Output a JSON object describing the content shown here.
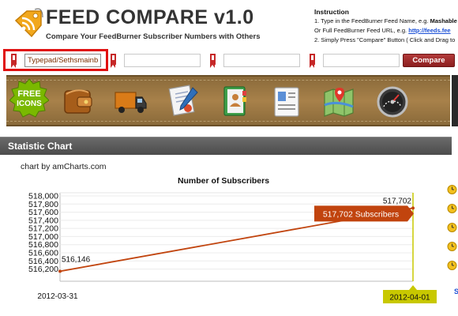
{
  "app": {
    "title": "FEED COMPARE v1.0",
    "subtitle": "Compare Your FeedBurner Subscriber Numbers with Others"
  },
  "instruction": {
    "heading": "Instruction",
    "line1_prefix": "1. Type in the FeedBurner Feed Name, e.g.",
    "line1_example": "Mashable",
    "line2_prefix": "Or Full FeedBurner Feed URL, e.g.",
    "line2_link": "http://feeds.fee",
    "line3": "2. Simply Press \"Compare\" Button ( Click and Drag to"
  },
  "feeds": {
    "inputs": [
      {
        "value": "Typepad/Sethsmainblog",
        "placeholder": ""
      },
      {
        "value": "",
        "placeholder": ""
      },
      {
        "value": "",
        "placeholder": ""
      },
      {
        "value": "",
        "placeholder": ""
      }
    ],
    "compare_label": "Compare"
  },
  "banner": {
    "badge_line1": "FREE",
    "badge_line2": "ICONS",
    "icons": [
      "wallet-icon",
      "delivery-truck-icon",
      "contract-icon",
      "address-book-icon",
      "id-card-icon",
      "map-icon",
      "speedometer-icon"
    ]
  },
  "panel": {
    "title": "Statistic Chart",
    "credit": "chart by amCharts.com"
  },
  "side": {
    "icons": [
      "alarm-clock-icon",
      "alarm-clock-icon",
      "alarm-clock-icon",
      "alarm-clock-icon",
      "alarm-clock-icon"
    ],
    "partial_text": "S"
  },
  "colors": {
    "series": "#c1440e",
    "highlight": "#e01010",
    "compare_button": "#9e2a2a",
    "cursor_label": "#c8c800"
  },
  "chart_data": {
    "type": "line",
    "title": "Number of Subscribers",
    "x": [
      "2012-03-31",
      "2012-04-01"
    ],
    "series": [
      {
        "values": [
          516146,
          517702
        ]
      }
    ],
    "ylim": [
      516200,
      518000
    ],
    "yticks": [
      "518,000",
      "517,800",
      "517,600",
      "517,400",
      "517,200",
      "517,000",
      "516,800",
      "516,600",
      "516,400",
      "516,200"
    ],
    "xtick_labels": [
      "2012-03-31",
      "2012-04-01"
    ],
    "data_labels": [
      "516,146",
      "517,702"
    ],
    "balloon_text": "517,702 Subscribers",
    "cursor_label": "2012-04-01",
    "grid": true,
    "xlabel": "",
    "ylabel": ""
  }
}
